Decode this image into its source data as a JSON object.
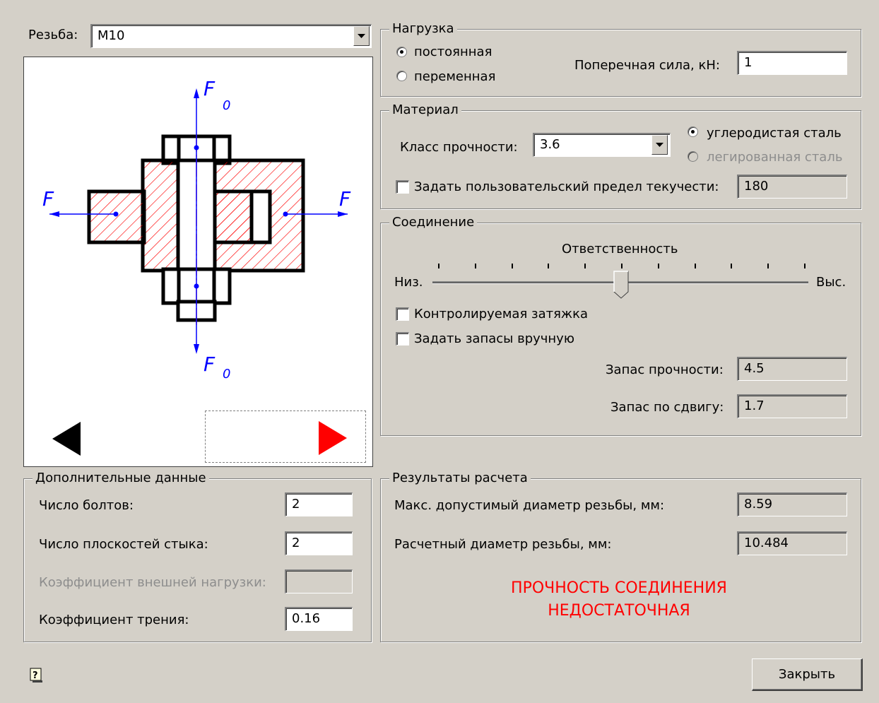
{
  "thread": {
    "label": "Резьба:",
    "value": "M10"
  },
  "diagram": {
    "force_label": "F",
    "axial_force_label": "F",
    "axial_force_sub": "0"
  },
  "load": {
    "title": "Нагрузка",
    "option_constant": "постоянная",
    "option_variable": "переменная",
    "selected": "постоянная",
    "shear_label": "Поперечная сила, кН:",
    "shear_value": "1"
  },
  "material": {
    "title": "Материал",
    "class_label": "Класс прочности:",
    "class_value": "3.6",
    "option_carbon": "углеродистая сталь",
    "option_alloy": "легированная сталь",
    "selected": "углеродистая сталь",
    "custom_yield_label": "Задать пользовательский предел текучести:",
    "custom_yield_checked": false,
    "custom_yield_value": "180"
  },
  "joint": {
    "title": "Соединение",
    "responsibility_label": "Ответственность",
    "slider_min": "Низ.",
    "slider_max": "Выс.",
    "slider_value": 0.5,
    "slider_ticks": 11,
    "controlled_tightening_label": "Контролируемая затяжка",
    "controlled_tightening_checked": false,
    "manual_margins_label": "Задать запасы вручную",
    "manual_margins_checked": false,
    "strength_margin_label": "Запас прочности:",
    "strength_margin_value": "4.5",
    "shear_margin_label": "Запас по сдвигу:",
    "shear_margin_value": "1.7"
  },
  "extra": {
    "title": "Дополнительные данные",
    "bolts_label": "Число болтов:",
    "bolts_value": "2",
    "planes_label": "Число плоскостей стыка:",
    "planes_value": "2",
    "load_factor_label": "Коэффициент внешней нагрузки:",
    "load_factor_value": "",
    "friction_label": "Коэффициент трения:",
    "friction_value": "0.16"
  },
  "results": {
    "title": "Результаты расчета",
    "max_diam_label": "Макс. допустимый диаметр резьбы, мм:",
    "max_diam_value": "8.59",
    "calc_diam_label": "Расчетный диаметр резьбы, мм:",
    "calc_diam_value": "10.484",
    "status_line1": "ПРОЧНОСТЬ СОЕДИНЕНИЯ",
    "status_line2": "НЕДОСТАТОЧНАЯ",
    "status_color": "#ff0000"
  },
  "buttons": {
    "close": "Закрыть"
  },
  "icons": {
    "help": "help-icon",
    "prev": "arrow-left-icon",
    "next": "arrow-right-icon",
    "dropdown": "chevron-down-icon"
  },
  "colors": {
    "hatch": "#ff0000",
    "force": "#0000ff",
    "active_arrow": "#ff0000"
  }
}
